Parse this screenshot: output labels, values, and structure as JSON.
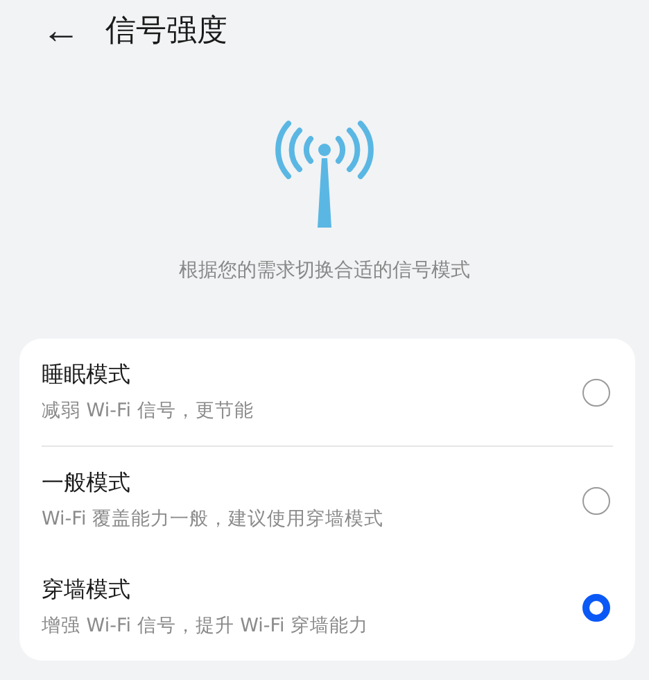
{
  "header": {
    "back": "←",
    "title": "信号强度"
  },
  "caption": "根据您的需求切换合适的信号模式",
  "modes": [
    {
      "title": "睡眠模式",
      "description": "减弱 Wi-Fi 信号，更节能",
      "selected": false
    },
    {
      "title": "一般模式",
      "description": "Wi-Fi 覆盖能力一般，建议使用穿墙模式",
      "selected": false
    },
    {
      "title": "穿墙模式",
      "description": "增强 Wi-Fi 信号，提升 Wi-Fi 穿墙能力",
      "selected": true
    }
  ]
}
